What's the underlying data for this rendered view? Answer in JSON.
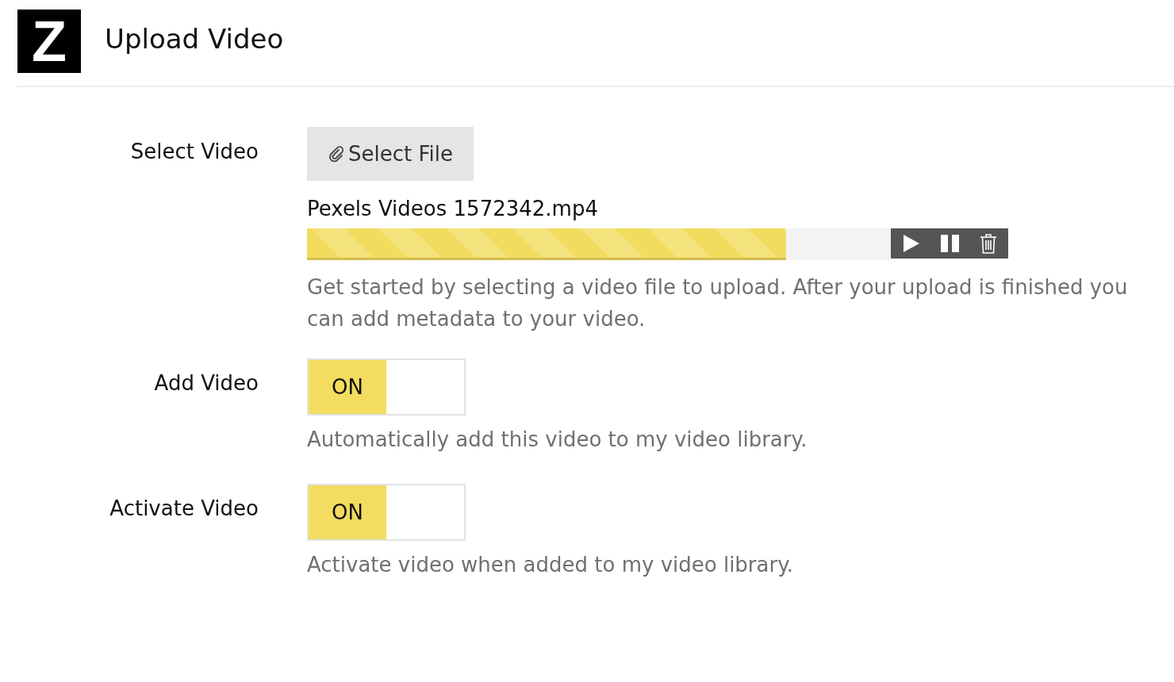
{
  "header": {
    "logo": "Z",
    "title": "Upload Video"
  },
  "rows": [
    {
      "kind": "file",
      "label": "Select Video",
      "button": "Select File",
      "file_name": "Pexels Videos 1572342.mp4",
      "progress": {
        "level": 0.82
      },
      "help": "Get started by selecting a video file to upload. After your upload is finished you can add metadata to your video."
    },
    {
      "kind": "toggle",
      "label": "Add Video",
      "toggle": {
        "on": true,
        "text": "ON"
      },
      "help": "Automatically add this video to my video library."
    },
    {
      "kind": "toggle",
      "label": "Activate Video",
      "toggle": {
        "on": true,
        "text": "ON"
      },
      "help": "Activate video when added to my video library."
    }
  ]
}
